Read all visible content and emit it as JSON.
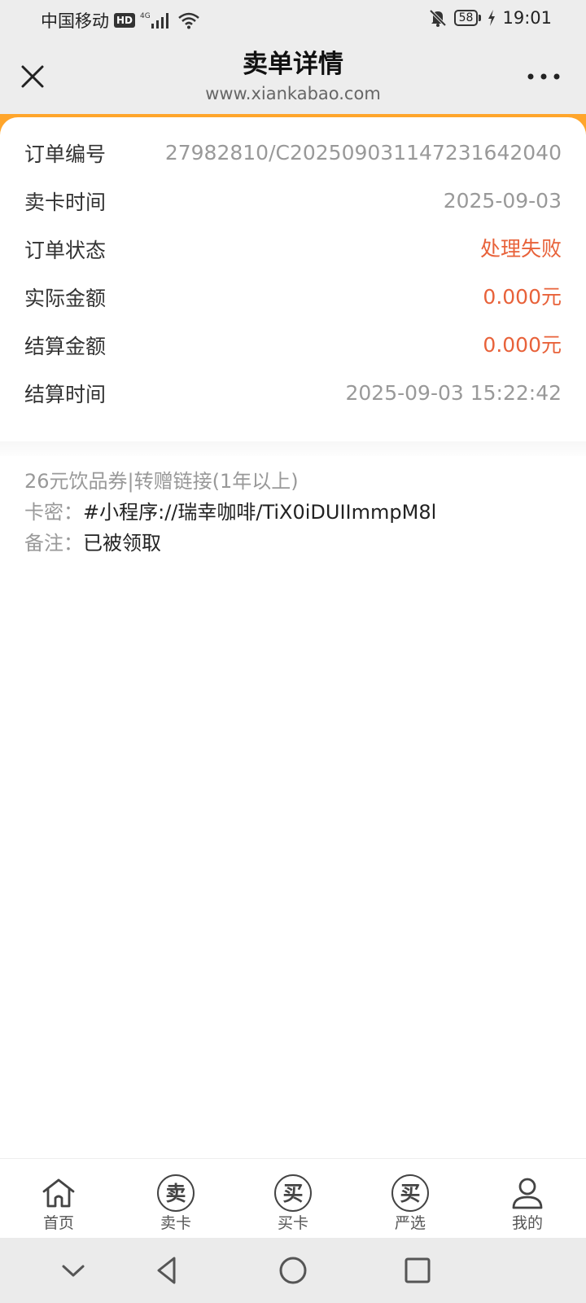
{
  "status_bar": {
    "carrier": "中国移动",
    "hd_badge": "HD",
    "network": "4G",
    "battery": "58",
    "time": "19:01"
  },
  "header": {
    "title": "卖单详情",
    "subtitle": "www.xiankabao.com"
  },
  "details": [
    {
      "label": "订单编号",
      "value": "27982810/C2025090311472316420 40"
    },
    {
      "label": "卖卡时间",
      "value": "2025-09-03"
    },
    {
      "label": "订单状态",
      "value": "处理失败"
    },
    {
      "label": "实际金额",
      "value": "0.000元"
    },
    {
      "label": "结算金额",
      "value": "0.000元"
    },
    {
      "label": "结算时间",
      "value": "2025-09-03 15:22:42"
    }
  ],
  "card_info": {
    "product": "26元饮品券|转赠链接(1年以上)",
    "secret_label": "卡密：",
    "secret_value": "#小程序://瑞幸咖啡/TiX0iDUIImmpM8l",
    "note_label": "备注：",
    "note_value": "已被领取"
  },
  "tabs": [
    {
      "label": "首页",
      "icon": "home-icon"
    },
    {
      "label": "卖卡",
      "icon": "sell-circle-icon",
      "glyph": "卖"
    },
    {
      "label": "买卡",
      "icon": "buy-circle-icon",
      "glyph": "买"
    },
    {
      "label": "严选",
      "icon": "select-circle-icon",
      "glyph": "买"
    },
    {
      "label": "我的",
      "icon": "user-icon"
    }
  ],
  "colors": {
    "accent_orange": "#ffa52b",
    "status_red": "#e8623a",
    "header_bg": "#ededed"
  }
}
